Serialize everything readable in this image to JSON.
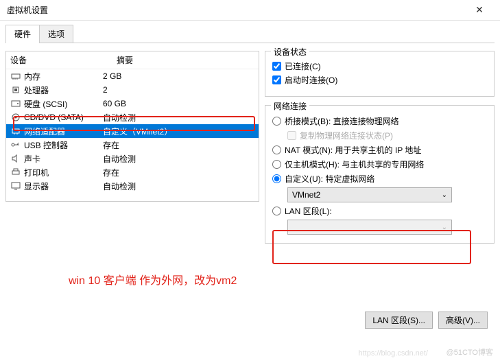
{
  "window": {
    "title": "虚拟机设置",
    "close": "✕"
  },
  "tabs": {
    "hardware": "硬件",
    "options": "选项"
  },
  "hw": {
    "col_device": "设备",
    "col_summary": "摘要",
    "rows": [
      {
        "name": "内存",
        "summary": "2 GB"
      },
      {
        "name": "处理器",
        "summary": "2"
      },
      {
        "name": "硬盘 (SCSI)",
        "summary": "60 GB"
      },
      {
        "name": "CD/DVD (SATA)",
        "summary": "自动检测"
      },
      {
        "name": "网络适配器",
        "summary": "自定义（VMnet2）"
      },
      {
        "name": "USB 控制器",
        "summary": "存在"
      },
      {
        "name": "声卡",
        "summary": "自动检测"
      },
      {
        "name": "打印机",
        "summary": "存在"
      },
      {
        "name": "显示器",
        "summary": "自动检测"
      }
    ]
  },
  "status": {
    "title": "设备状态",
    "connected": "已连接(C)",
    "connect_on": "启动时连接(O)"
  },
  "net": {
    "title": "网络连接",
    "bridged": "桥接模式(B): 直接连接物理网络",
    "replicate": "复制物理网络连接状态(P)",
    "nat": "NAT 模式(N): 用于共享主机的 IP 地址",
    "hostonly": "仅主机模式(H): 与主机共享的专用网络",
    "custom": "自定义(U): 特定虚拟网络",
    "custom_val": "VMnet2",
    "lan": "LAN 区段(L):"
  },
  "buttons": {
    "lan_seg": "LAN 区段(S)...",
    "advanced": "高级(V)..."
  },
  "annotation": "win 10 客户端 作为外网，改为vm2",
  "watermark": "@51CTO博客",
  "watermark2": "https://blog.csdn.net/"
}
